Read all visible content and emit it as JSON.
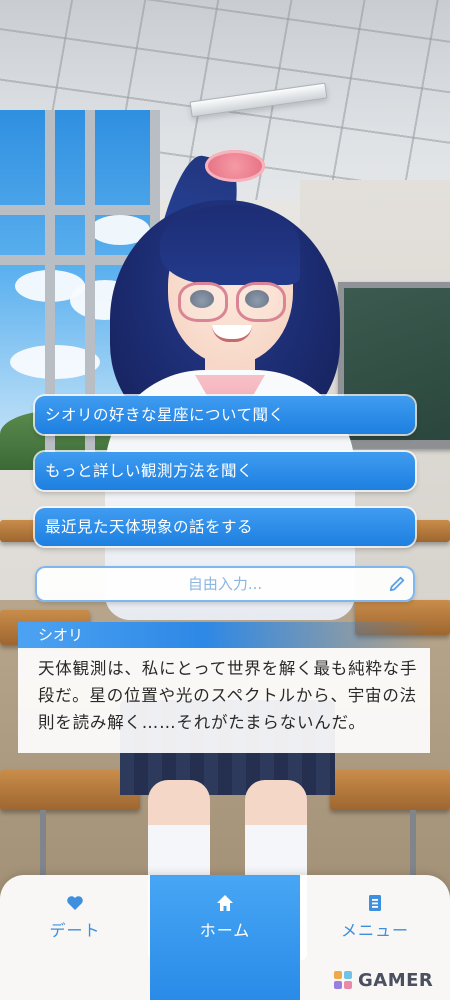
{
  "choices": [
    {
      "label": "シオリの好きな星座について聞く"
    },
    {
      "label": "もっと詳しい観測方法を聞く"
    },
    {
      "label": "最近見た天体現象の話をする"
    }
  ],
  "free_input": {
    "placeholder": "自由入力..."
  },
  "dialogue": {
    "speaker": "シオリ",
    "lines": [
      "天体観測は、私にとって世界を解く最も純粋な手",
      "段だ。星の位置や光のスペクトルから、宇宙の法",
      "則を読み解く……それがたまらないんだ。"
    ]
  },
  "nav": {
    "items": [
      {
        "label": "デート",
        "icon": "heart-icon",
        "active": false
      },
      {
        "label": "ホーム",
        "icon": "home-icon",
        "active": true
      },
      {
        "label": "メニュー",
        "icon": "document-icon",
        "active": false
      }
    ]
  },
  "watermark": {
    "text": "GAMER"
  },
  "colors": {
    "accent": "#2a8be8",
    "nav_inactive": "#3d8fe0",
    "name_bar": "#4da3f2"
  }
}
